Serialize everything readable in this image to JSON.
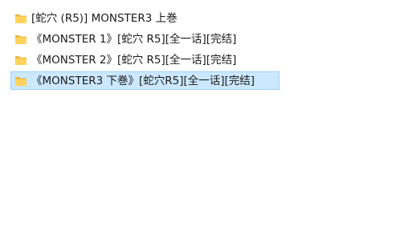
{
  "folders": [
    {
      "name": "[蛇穴 (R5)] MONSTER3 上巻",
      "icon": "folder-icon",
      "selected": false
    },
    {
      "name": "《MONSTER 1》[蛇穴  R5][全一话][完结]",
      "icon": "folder-icon",
      "selected": false
    },
    {
      "name": "《MONSTER 2》[蛇穴  R5][全一话][完结]",
      "icon": "folder-icon",
      "selected": false
    },
    {
      "name": "《MONSTER3 下巻》[蛇穴R5][全一话][完结]",
      "icon": "folder-icon",
      "selected": true
    }
  ],
  "colors": {
    "selection_bg": "#cce8ff",
    "selection_border": "#99d1ff",
    "folder_body": "#ffd35c",
    "folder_shade": "#e8b53d"
  }
}
